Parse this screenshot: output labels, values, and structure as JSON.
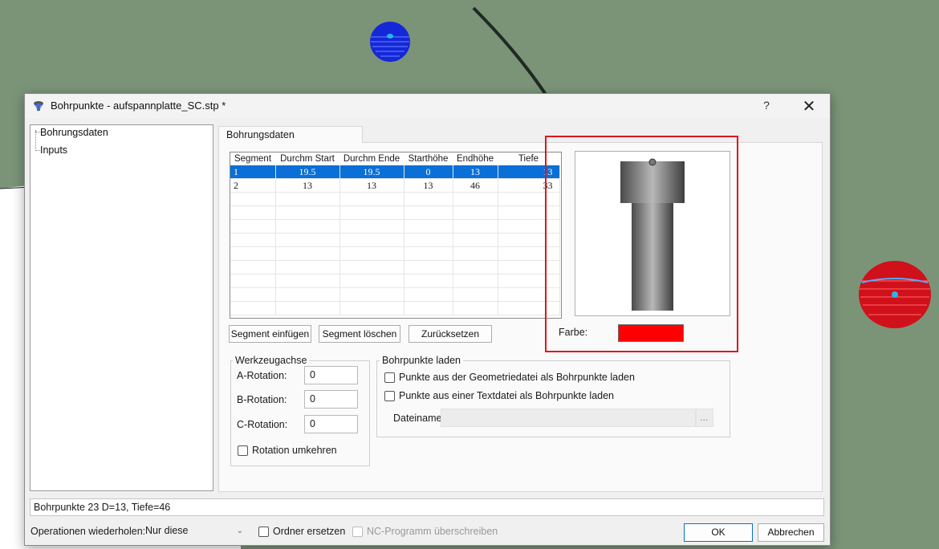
{
  "dialog": {
    "title": "Bohrpunkte - aufspannplatte_SC.stp *",
    "help_glyph": "?",
    "close_glyph": "✕"
  },
  "tree": {
    "items": [
      {
        "label": "Bohrungsdaten"
      },
      {
        "label": "Inputs"
      }
    ]
  },
  "tab": {
    "label": "Bohrungsdaten"
  },
  "table": {
    "headers": [
      "Segment",
      "Durchm Start",
      "Durchm Ende",
      "Starthöhe",
      "Endhöhe",
      "Tiefe"
    ],
    "rows": [
      [
        "1",
        "19.5",
        "19.5",
        "0",
        "13",
        "13"
      ],
      [
        "2",
        "13",
        "13",
        "13",
        "46",
        "33"
      ]
    ],
    "selected_row": 1
  },
  "buttons": {
    "insert": "Segment einfügen",
    "delete": "Segment löschen",
    "reset": "Zurücksetzen"
  },
  "farbe": {
    "label": "Farbe:",
    "color": "#ff0000"
  },
  "axis_group": {
    "title": "Werkzeugachse",
    "a_label": "A-Rotation:",
    "a_value": "0",
    "b_label": "B-Rotation:",
    "b_value": "0",
    "c_label": "C-Rotation:",
    "c_value": "0",
    "reverse_label": "Rotation umkehren"
  },
  "load_group": {
    "title": "Bohrpunkte laden",
    "opt_geometry": "Punkte aus der Geometriedatei als Bohrpunkte laden",
    "opt_text": "Punkte aus einer Textdatei als Bohrpunkte laden",
    "filename_label": "Dateiname:",
    "filename_value": "",
    "browse": "..."
  },
  "status": {
    "text": "Bohrpunkte 23 D=13, Tiefe=46"
  },
  "footer": {
    "repeat_label": "Operationen wiederholen:",
    "repeat_value": "Nur diese",
    "replace_folder": "Ordner ersetzen",
    "overwrite_nc": "NC-Programm überschreiben",
    "ok": "OK",
    "cancel": "Abbrechen"
  },
  "colors": {
    "background": "#7b9478",
    "selection": "#0a6fd6",
    "highlight_frame": "#e0161d"
  }
}
